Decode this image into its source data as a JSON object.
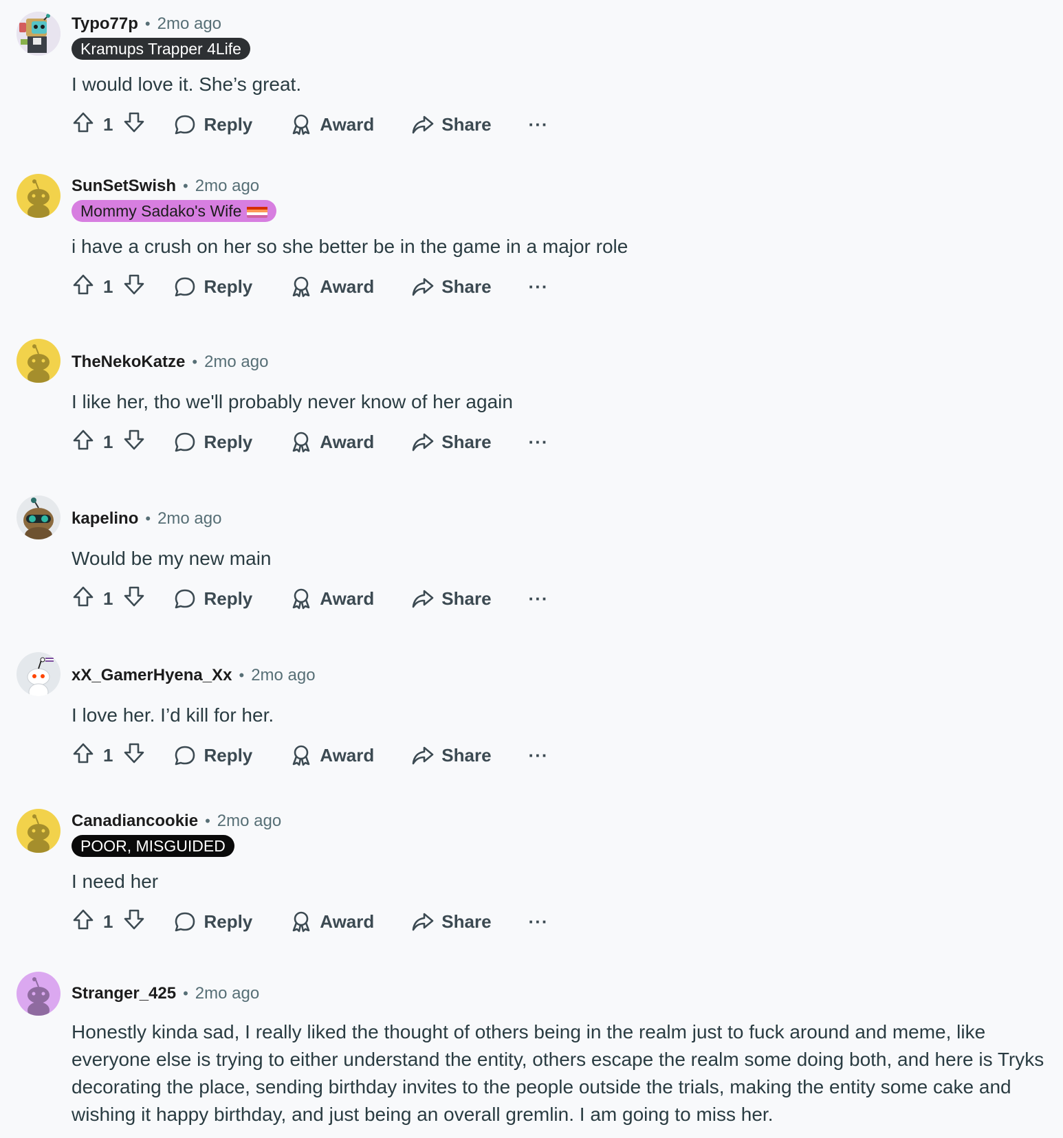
{
  "comments": [
    {
      "username": "Typo77p",
      "time": "2mo ago",
      "flair": "Kramups Trapper 4Life",
      "text": "I would love it. She’s great.",
      "votes": "1",
      "avatar": "robot-avatar"
    },
    {
      "username": "SunSetSwish",
      "time": "2mo ago",
      "flair": "Mommy Sadako's Wife",
      "text": "i have a crush on her so she better be in the game in a major role",
      "votes": "1",
      "avatar": "default-yellow-avatar"
    },
    {
      "username": "TheNekoKatze",
      "time": "2mo ago",
      "flair": "",
      "text": "I like her, tho we'll probably never know of her again",
      "votes": "1",
      "avatar": "default-yellow-avatar"
    },
    {
      "username": "kapelino",
      "time": "2mo ago",
      "flair": "",
      "text": "Would be my new main",
      "votes": "1",
      "avatar": "goggles-avatar"
    },
    {
      "username": "xX_GamerHyena_Xx",
      "time": "2mo ago",
      "flair": "",
      "text": "I love her. I’d kill for her.",
      "votes": "1",
      "avatar": "snoo-avatar"
    },
    {
      "username": "Canadiancookie",
      "time": "2mo ago",
      "flair": "POOR, MISGUIDED",
      "text": "I need her",
      "votes": "1",
      "avatar": "default-yellow-avatar"
    },
    {
      "username": "Stranger_425",
      "time": "2mo ago",
      "flair": "",
      "text": "Honestly kinda sad, I really liked the thought of others being in the realm just to fuck around and meme, like everyone else is trying to either understand the entity, others escape the realm some doing both, and here is Tryks decorating the place, sending birthday invites to the people outside the trials, making the entity some cake and wishing it happy birthday, and just being an overall gremlin. I am going to miss her.",
      "votes": "",
      "avatar": "default-purple-avatar"
    }
  ],
  "actions": {
    "reply": "Reply",
    "award": "Award",
    "share": "Share",
    "more": "···",
    "separator": "•"
  },
  "colors": {
    "background": "#f8f9fb",
    "meta_gray": "#576f76",
    "yellow_avatar": "#f2d24b",
    "purple_avatar": "#dba8f0",
    "flair_dark": "#2d3033",
    "flair_pink": "#d77ee0"
  }
}
